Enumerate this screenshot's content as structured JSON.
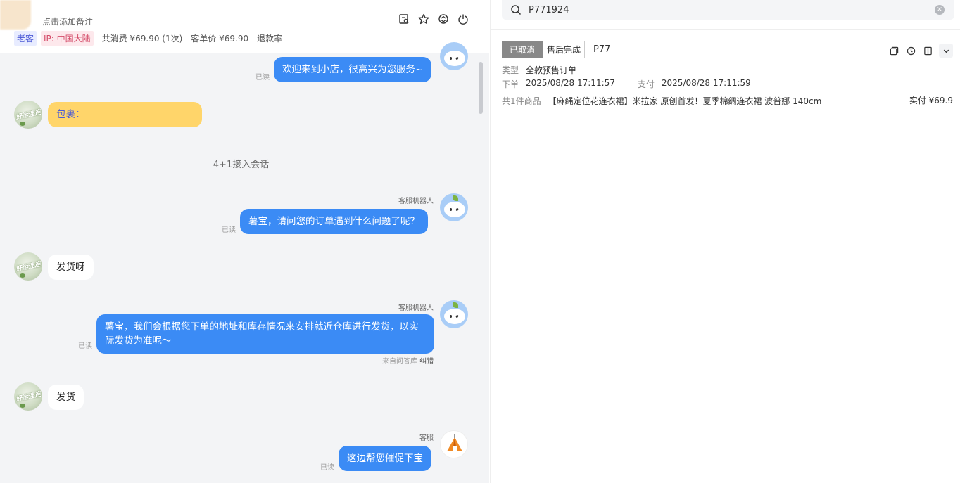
{
  "chat": {
    "note_link": "点击添加备注",
    "tags": {
      "old_customer": "老客",
      "ip": "IP: 中国大陆"
    },
    "meta": {
      "spent": "共消费 ¥69.90 (1次)",
      "unit_price": "客单价 ¥69.90",
      "refund_rate": "退款率 -"
    },
    "system_message": "4+1接入会话",
    "messages": [
      {
        "text": "欢迎来到小店，很高兴为您服务~",
        "read": "已读"
      },
      {
        "text": "包裹：",
        "from": "customer"
      },
      {
        "sender": "客服机器人",
        "text": "薯宝，请问您的订单遇到什么问题了呢？",
        "read": "已读"
      },
      {
        "text": "发货呀",
        "from": "customer"
      },
      {
        "sender": "客服机器人",
        "text": "薯宝，我们会根据您下单的地址和库存情况来安排就近仓库进行发货，以实际发货为准呢～",
        "read": "已读",
        "footnote": "来自问答库",
        "footnote_link": "纠错"
      },
      {
        "text": "发货",
        "from": "customer"
      },
      {
        "sender": "客服",
        "text": "这边帮您催促下宝",
        "read": "已读"
      }
    ]
  },
  "order": {
    "search_value": "P771924",
    "status_cancel": "已取消",
    "status_after": "售后完成",
    "order_no": "P77",
    "type_label": "类型",
    "type_value": "全款预售订单",
    "placed_label": "下单",
    "placed_value": "2025/08/28 17:11:57",
    "pay_label": "支付",
    "pay_value": "2025/08/28 17:11:59",
    "items_label": "共1件商品",
    "item_name": "【麻绳定位花连衣裙】米拉家 原创首发！夏季棉绸连衣裙 波普娜 140cm",
    "paid": "实付 ¥69.9"
  }
}
